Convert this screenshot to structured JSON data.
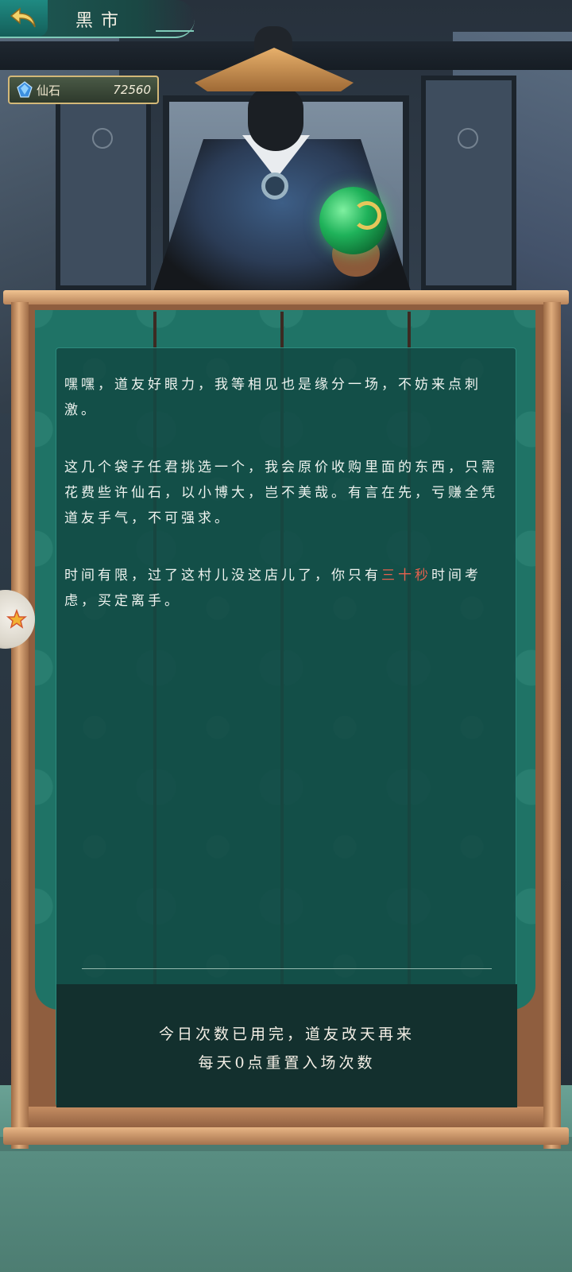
{
  "header": {
    "title": "黑市"
  },
  "currency": {
    "label": "仙石",
    "value": "72560",
    "icon": "spirit-stone-icon"
  },
  "dialogue": {
    "para1": "嘿嘿，道友好眼力，我等相见也是缘分一场，不妨来点刺激。",
    "para2": "这几个袋子任君挑选一个，我会原价收购里面的东西，只需花费些许仙石，以小博大，岂不美哉。有言在先，亏赚全凭道友手气，不可强求。",
    "para3_before": "时间有限，过了这村儿没这店儿了，你只有",
    "para3_highlight": "三十秒",
    "para3_after": "时间考虑，买定离手。"
  },
  "status": {
    "line1": "今日次数已用完，道友改天再来",
    "line2": "每天0点重置入场次数"
  },
  "colors": {
    "panel_teal": "#124a44",
    "curtain_teal": "#1f7366",
    "highlight_red": "#e5614e",
    "wood": "#b8845a",
    "currency_border": "#d3b878"
  }
}
